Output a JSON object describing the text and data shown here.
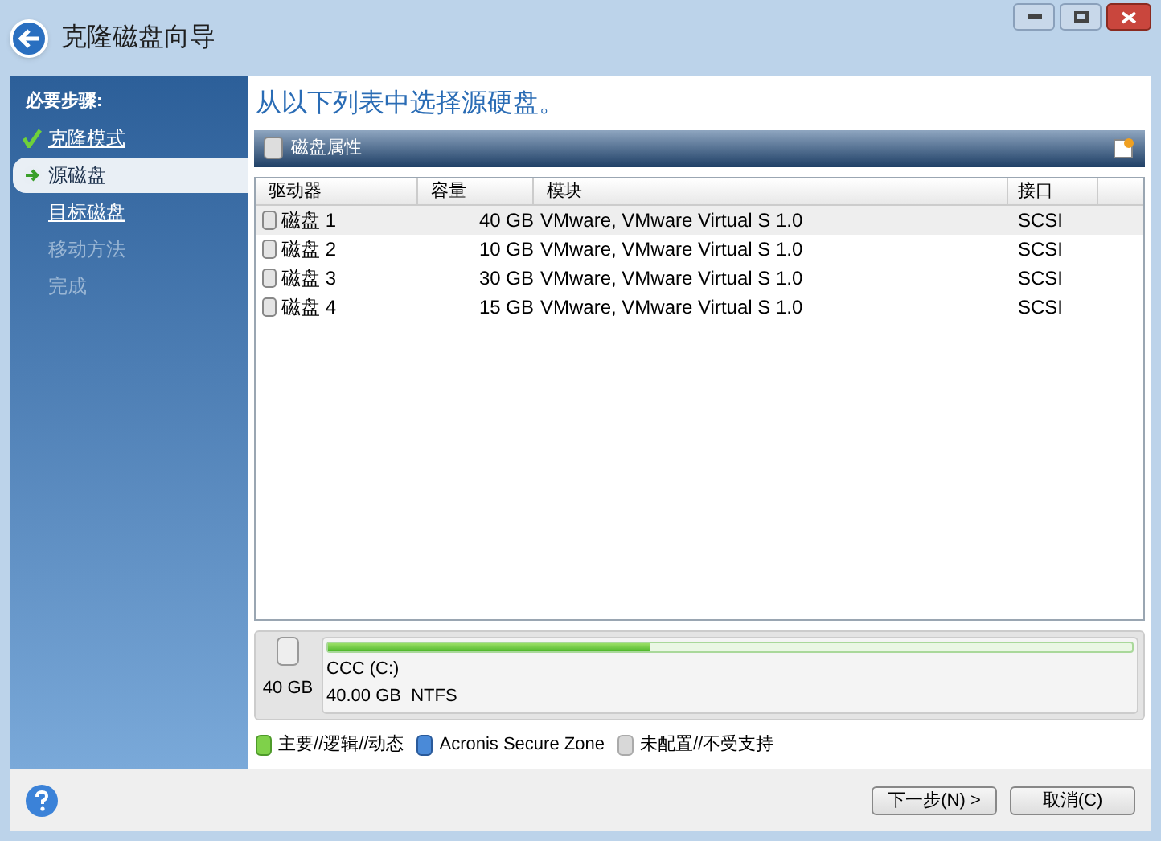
{
  "window": {
    "title": "克隆磁盘向导"
  },
  "sidebar": {
    "heading": "必要步骤:",
    "steps": [
      {
        "label": "克隆模式",
        "kind": "done"
      },
      {
        "label": "源磁盘",
        "kind": "current"
      },
      {
        "label": "目标磁盘",
        "kind": "link"
      },
      {
        "label": "移动方法",
        "kind": "disabled"
      },
      {
        "label": "完成",
        "kind": "disabled"
      }
    ]
  },
  "main": {
    "heading": "从以下列表中选择源硬盘。",
    "toolbar": {
      "label": "磁盘属性"
    },
    "table": {
      "columns": [
        "驱动器",
        "容量",
        "模块",
        "接口"
      ],
      "rows": [
        {
          "drive": "磁盘 1",
          "capacity": "40 GB",
          "model": "VMware, VMware Virtual S 1.0",
          "interface": "SCSI",
          "selected": true
        },
        {
          "drive": "磁盘 2",
          "capacity": "10 GB",
          "model": "VMware, VMware Virtual S 1.0",
          "interface": "SCSI",
          "selected": false
        },
        {
          "drive": "磁盘 3",
          "capacity": "30 GB",
          "model": "VMware, VMware Virtual S 1.0",
          "interface": "SCSI",
          "selected": false
        },
        {
          "drive": "磁盘 4",
          "capacity": "15 GB",
          "model": "VMware, VMware Virtual S 1.0",
          "interface": "SCSI",
          "selected": false
        }
      ]
    },
    "disk": {
      "size": "40 GB",
      "partition": {
        "name": "CCC (C:)",
        "detail": "40.00 GB  NTFS",
        "level": 0.4
      }
    },
    "legend": [
      {
        "label": "主要//逻辑//动态",
        "kind": "primary"
      },
      {
        "label": "Acronis Secure Zone",
        "kind": "secure"
      },
      {
        "label": "未配置//不受支持",
        "kind": "unallocated"
      }
    ]
  },
  "footer": {
    "buttons": [
      "下一步(N) >",
      "取消(C)"
    ]
  }
}
